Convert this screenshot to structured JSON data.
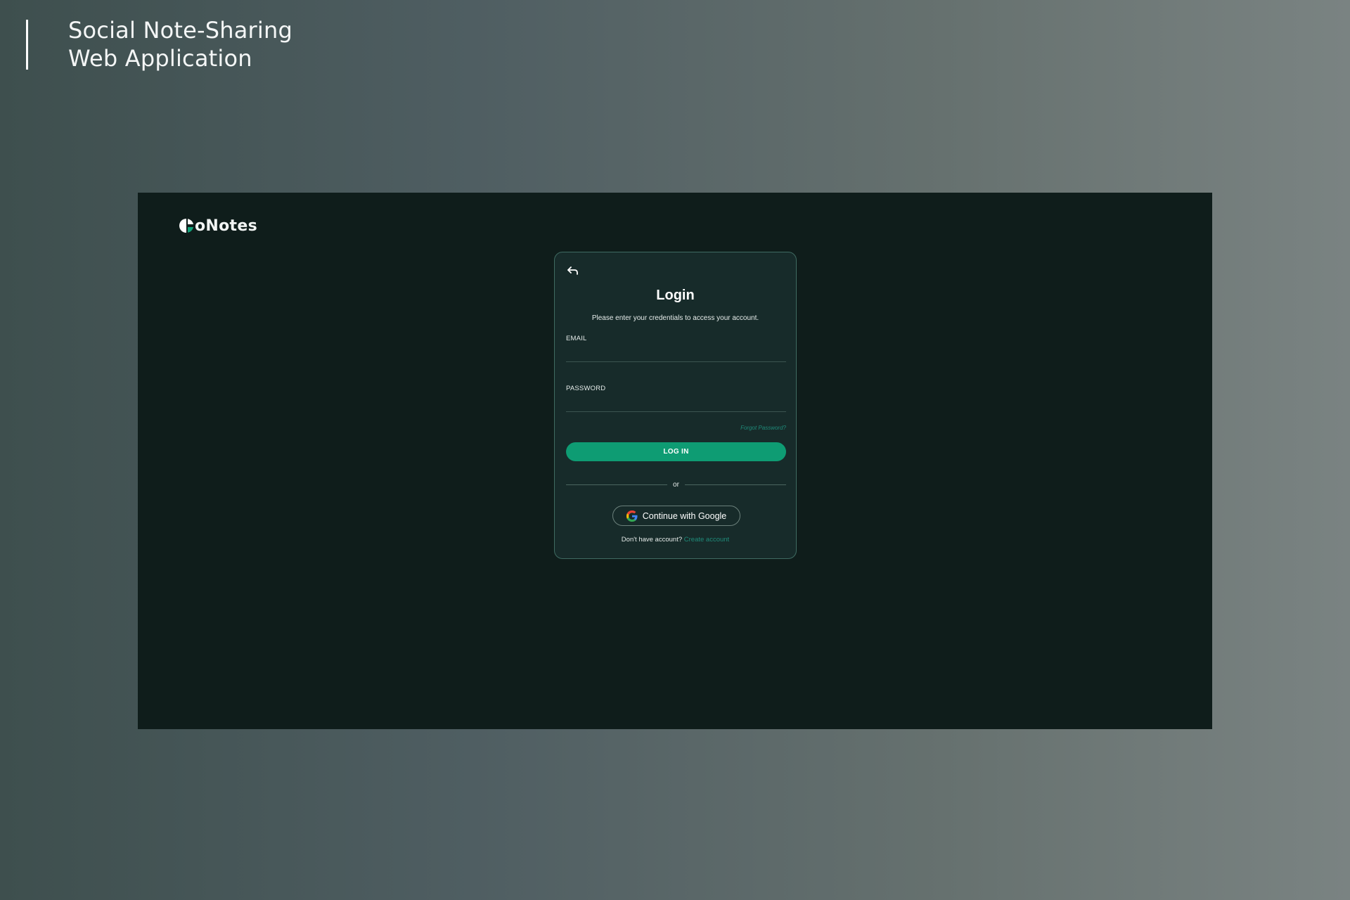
{
  "project": {
    "title_line1": "Social Note-Sharing",
    "title_line2": "Web Application"
  },
  "app": {
    "logo_text": "oNotes",
    "logo_icon": "half-circle-logo-icon"
  },
  "login": {
    "back_icon": "back-arrow-icon",
    "title": "Login",
    "subtitle": "Please enter your credentials to access your account.",
    "email_label": "EMAIL",
    "email_value": "",
    "password_label": "PASSWORD",
    "password_value": "",
    "forgot_label": "Forgot Password?",
    "login_button_label": "LOG IN",
    "divider_text": "or",
    "google_button_label": "Continue with Google",
    "google_icon": "google-icon",
    "signup_prompt": "Don't have account?",
    "signup_link": "Create account"
  },
  "colors": {
    "frame_background": "#0f1d1b",
    "card_background": "#172b2a",
    "card_border": "#3f6b62",
    "primary_button": "#0e9c73",
    "link": "#1f8a79"
  }
}
